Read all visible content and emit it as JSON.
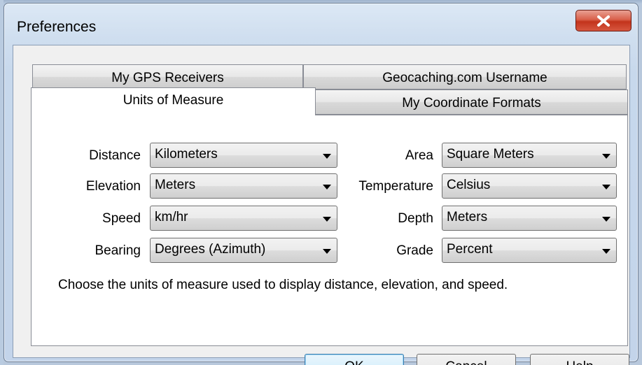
{
  "window": {
    "title": "Preferences",
    "close_icon": "close-icon"
  },
  "tabs": {
    "row_back": [
      {
        "label": "My GPS Receivers"
      },
      {
        "label": "Geocaching.com Username"
      }
    ],
    "row_front": [
      {
        "label": "Units of Measure",
        "selected": true
      },
      {
        "label": "My Coordinate Formats"
      }
    ]
  },
  "units": {
    "distance": {
      "label": "Distance",
      "value": "Kilometers"
    },
    "elevation": {
      "label": "Elevation",
      "value": "Meters"
    },
    "speed": {
      "label": "Speed",
      "value": "km/hr"
    },
    "bearing": {
      "label": "Bearing",
      "value": "Degrees (Azimuth)"
    },
    "area": {
      "label": "Area",
      "value": "Square Meters"
    },
    "temperature": {
      "label": "Temperature",
      "value": "Celsius"
    },
    "depth": {
      "label": "Depth",
      "value": "Meters"
    },
    "grade": {
      "label": "Grade",
      "value": "Percent"
    },
    "hint": "Choose the units of measure used to display distance, elevation, and speed."
  },
  "buttons": {
    "ok": "OK",
    "cancel": "Cancel",
    "help": "Help"
  },
  "colors": {
    "close_button": "#c7432b",
    "default_button_border": "#3c7fb1",
    "window_frame": "#c3d4ea"
  }
}
